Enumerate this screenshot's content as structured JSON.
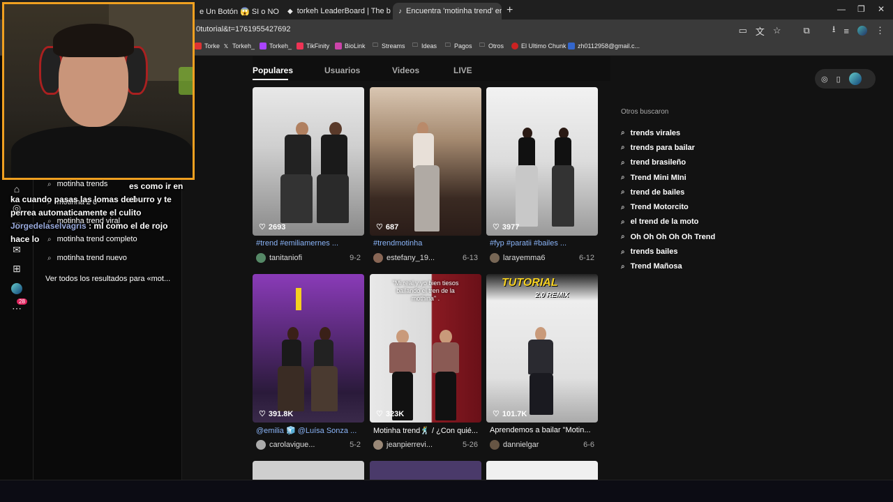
{
  "browser": {
    "tabs": [
      {
        "title": "e Un Botón 😱 SI o NO ✅ ",
        "active": false
      },
      {
        "title": "torkeh LeaderBoard | The best C",
        "active": false
      },
      {
        "title": "Encuentra 'motinha trend' en T",
        "active": true
      }
    ],
    "url": "0tutorial&t=1761955427692",
    "bookmarks": [
      "Torke",
      "Torkeh_",
      "Torkeh_",
      "TikFinity",
      "BioLink",
      "Streams",
      "Ideas",
      "Pagos",
      "Otros",
      "El Ultimo Chunk",
      "zh0112958@gmail.c..."
    ]
  },
  "suggestions": {
    "items": [
      "motinha trends",
      "motinha 2 0",
      "motinha trend viral",
      "motinha trend completo",
      "motinha trend nuevo"
    ],
    "see_all": "Ver todos los resultados para «mot..."
  },
  "left_rail": {
    "badge": "28"
  },
  "search_tabs": [
    "Populares",
    "Usuarios",
    "Videos",
    "LIVE"
  ],
  "videos": [
    {
      "likes": "2693",
      "caption": "#trend #emiliamernes ...",
      "caption_is_tag": true,
      "user": "tanitaniofi",
      "date": "9-2"
    },
    {
      "likes": "687",
      "caption": "#trendmotinha",
      "caption_is_tag": true,
      "user": "estefany_19...",
      "date": "6-13"
    },
    {
      "likes": "3977",
      "caption": "#fyp #paratii #bailes ...",
      "caption_is_tag": true,
      "user": "larayemma6",
      "date": "6-12"
    },
    {
      "likes": "391.8K",
      "caption": "@emilia 🧊 @Luísa Sonza ...",
      "caption_is_tag": true,
      "user": "carolavigue...",
      "date": "5-2"
    },
    {
      "likes": "323K",
      "caption": "Motinha trend🕺 / ¿Con quié...",
      "caption_is_tag": false,
      "user": "jeanpierrevi...",
      "date": "5-26",
      "overlay_text": "\"Mi real y yo bien tiesos bailando el tren de la mothina\" ."
    },
    {
      "likes": "101.7K",
      "caption": "Aprendemos a bailar \"Motin...",
      "caption_is_tag": false,
      "user": "dannielgar",
      "date": "6-6",
      "overlay_text": "TUTORIAL",
      "overlay_sub": "2.0 REMIX"
    }
  ],
  "others": {
    "title": "Otros buscaron",
    "items": [
      "trends virales",
      "trends para bailar",
      "trend brasileño",
      "Trend Mini MIni",
      "trend de bailes",
      "Trend Motorcito",
      "el trend de la moto",
      "Oh Oh Oh Oh Oh Trend",
      "trends bailes",
      "Trend Mañosa"
    ]
  },
  "chat": [
    {
      "user": "",
      "text": "ka cuando pasas las lomas de burro y te perrea automaticamente el culito"
    },
    {
      "user": "Jorgedelaselvagris",
      "text": ": ml como el de rojo hace lo"
    }
  ],
  "chat_top_partial": "es como ir en el",
  "colors": {
    "accent": "#f0a020",
    "tag": "#8ab4f8",
    "badge": "#e0245e"
  }
}
